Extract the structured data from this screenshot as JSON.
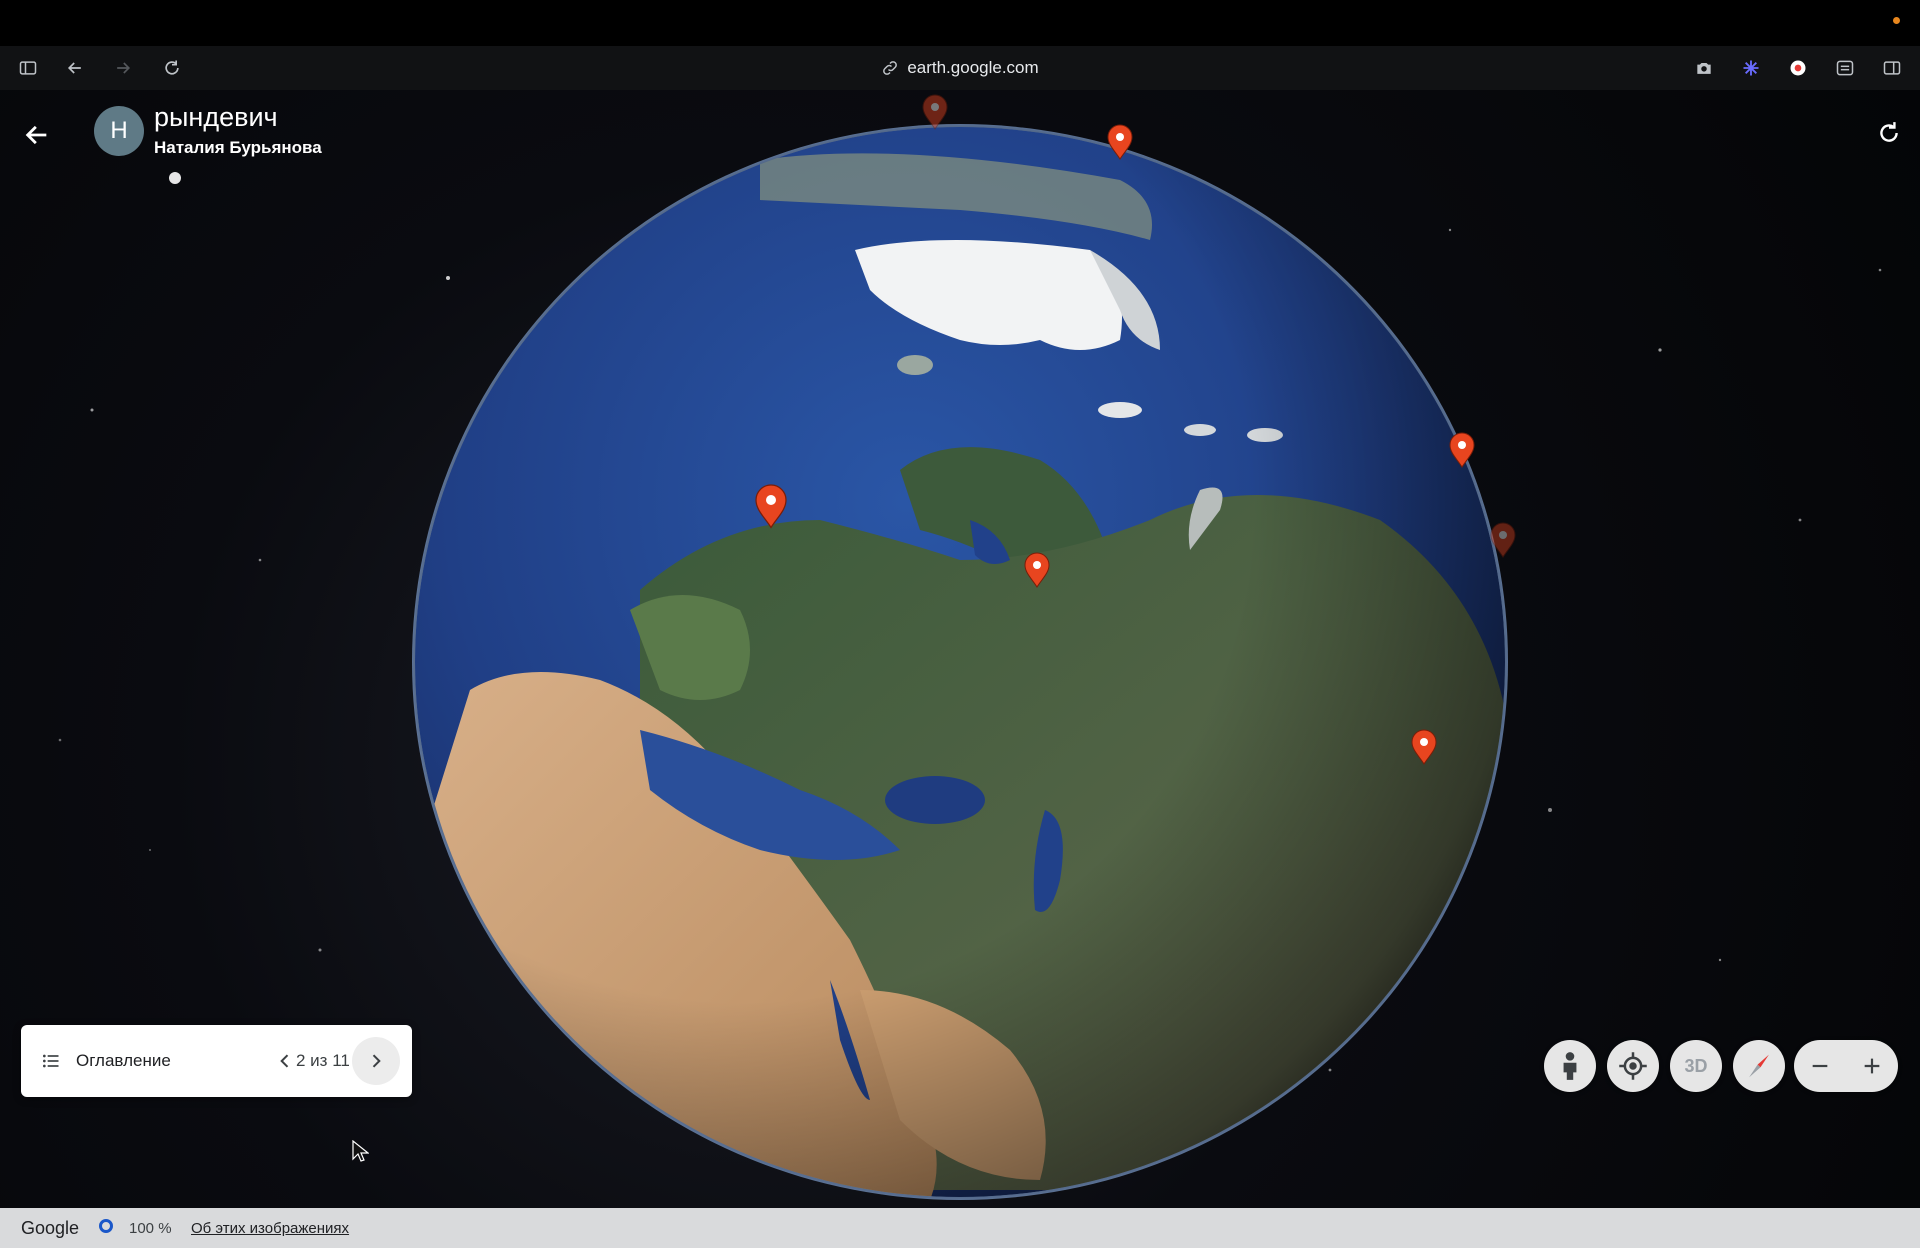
{
  "browser": {
    "url": "earth.google.com",
    "icons": [
      "sidebar-icon",
      "back-icon",
      "forward-icon",
      "reload-icon",
      "link-icon",
      "camera-icon",
      "extension-icon",
      "record-icon",
      "tune-icon",
      "split-view-icon"
    ]
  },
  "project": {
    "avatar_letter": "Н",
    "title": "рындевич",
    "author": "Наталия Бурьянова"
  },
  "toc": {
    "label": "Оглавление",
    "position": "2 из 11"
  },
  "controls": {
    "view_3d_label": "3D",
    "zoom_out": "−",
    "zoom_in": "+"
  },
  "status": {
    "brand": "Google",
    "percent": "100 %",
    "about_link": "Об этих изображениях"
  },
  "colors": {
    "pin": "#e8451f",
    "accent_blue": "#1a57c9",
    "os_dot": "#e8871e"
  }
}
